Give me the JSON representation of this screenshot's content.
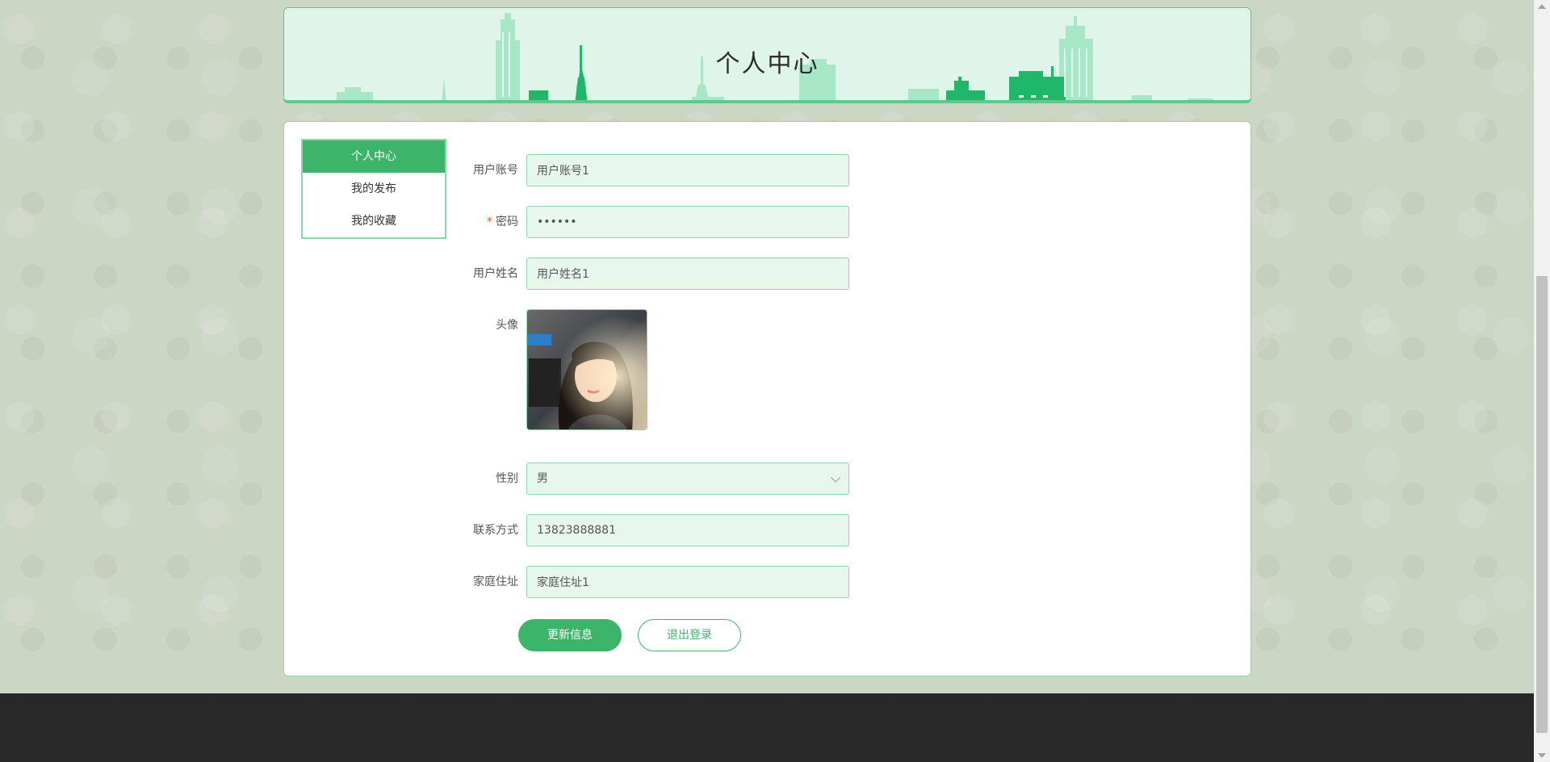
{
  "header": {
    "title": "个人中心"
  },
  "menu": {
    "items": [
      {
        "label": "个人中心",
        "active": true
      },
      {
        "label": "我的发布",
        "active": false
      },
      {
        "label": "我的收藏",
        "active": false
      }
    ]
  },
  "form": {
    "account": {
      "label": "用户账号",
      "value": "用户账号1"
    },
    "password": {
      "required_mark": "*",
      "label": "密码",
      "value": "••••••"
    },
    "name": {
      "label": "用户姓名",
      "value": "用户姓名1"
    },
    "avatar": {
      "label": "头像"
    },
    "gender": {
      "label": "性别",
      "value": "男"
    },
    "phone": {
      "label": "联系方式",
      "value": "13823888881"
    },
    "address": {
      "label": "家庭住址",
      "value": "家庭住址1"
    }
  },
  "actions": {
    "update_label": "更新信息",
    "logout_label": "退出登录"
  },
  "colors": {
    "accent": "#3cb46a",
    "accent_light": "#8dd8a9",
    "input_bg": "#e8f7ee",
    "banner_bg": "#e0f5ea",
    "footer_bg": "#282828",
    "page_bg": "#ccd6c4"
  }
}
